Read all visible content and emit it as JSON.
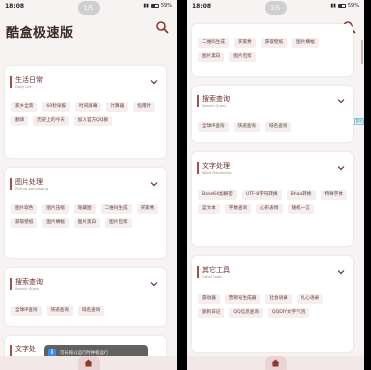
{
  "app": {
    "title": "酷盒极速版"
  },
  "left": {
    "status": {
      "time": "18:08",
      "battery": "59%"
    },
    "pager": "1/5",
    "cards": [
      {
        "title": "生活日常",
        "subtitle": "Daily Life",
        "chips": [
          "家乡全景",
          "60秒早报",
          "时间屏幕",
          "计算器",
          "指南针",
          "翻译",
          "历史上的今天",
          "加入官方QQ群"
        ]
      },
      {
        "title": "图片处理",
        "subtitle": "Picture processing",
        "chips": [
          "图片取色",
          "图片压缩",
          "隐藏图",
          "二维码生成",
          "买家秀",
          "获取壁纸",
          "图片横幅",
          "图片黑白",
          "图片包浆"
        ]
      },
      {
        "title": "搜索查询",
        "subtitle": "Search Query",
        "chips": [
          "全球IP查询",
          "快递查询",
          "域名查询"
        ]
      },
      {
        "title": "文字处",
        "subtitle": "",
        "chips": []
      }
    ],
    "toast": "可长按以运行时钟板运行"
  },
  "right": {
    "status": {
      "time": "18:08",
      "battery": "59%"
    },
    "pager": "2/5",
    "side_tab": "显示",
    "cards": [
      {
        "title": "",
        "subtitle": "",
        "chips": [
          "二维码生成",
          "买家秀",
          "获取壁纸",
          "图片横幅",
          "图片黑白",
          "图片包浆"
        ]
      },
      {
        "title": "搜索查询",
        "subtitle": "Search Query",
        "chips": [
          "全球IP查询",
          "快递查询",
          "域名查询"
        ]
      },
      {
        "title": "文字处理",
        "subtitle": "Word Processing",
        "chips": [
          "Base64加解密",
          "UTF-8字符转换",
          "Bhao转换",
          "特殊字体",
          "蓝文本",
          "字数查询",
          "心形表情",
          "随机一言"
        ]
      },
      {
        "title": "其它工具",
        "subtitle": "Other tools",
        "chips": [
          "震动器",
          "营销号生成器",
          "社会语录",
          "扎心语录",
          "舔狗日记",
          "QQ信息查询",
          "QQDIY文字气泡"
        ]
      }
    ]
  },
  "colors": {
    "accent": "#a0524a",
    "title": "#6a2e28",
    "chip_bg": "#f6eeee",
    "page_bg": "#f8f3f3"
  }
}
